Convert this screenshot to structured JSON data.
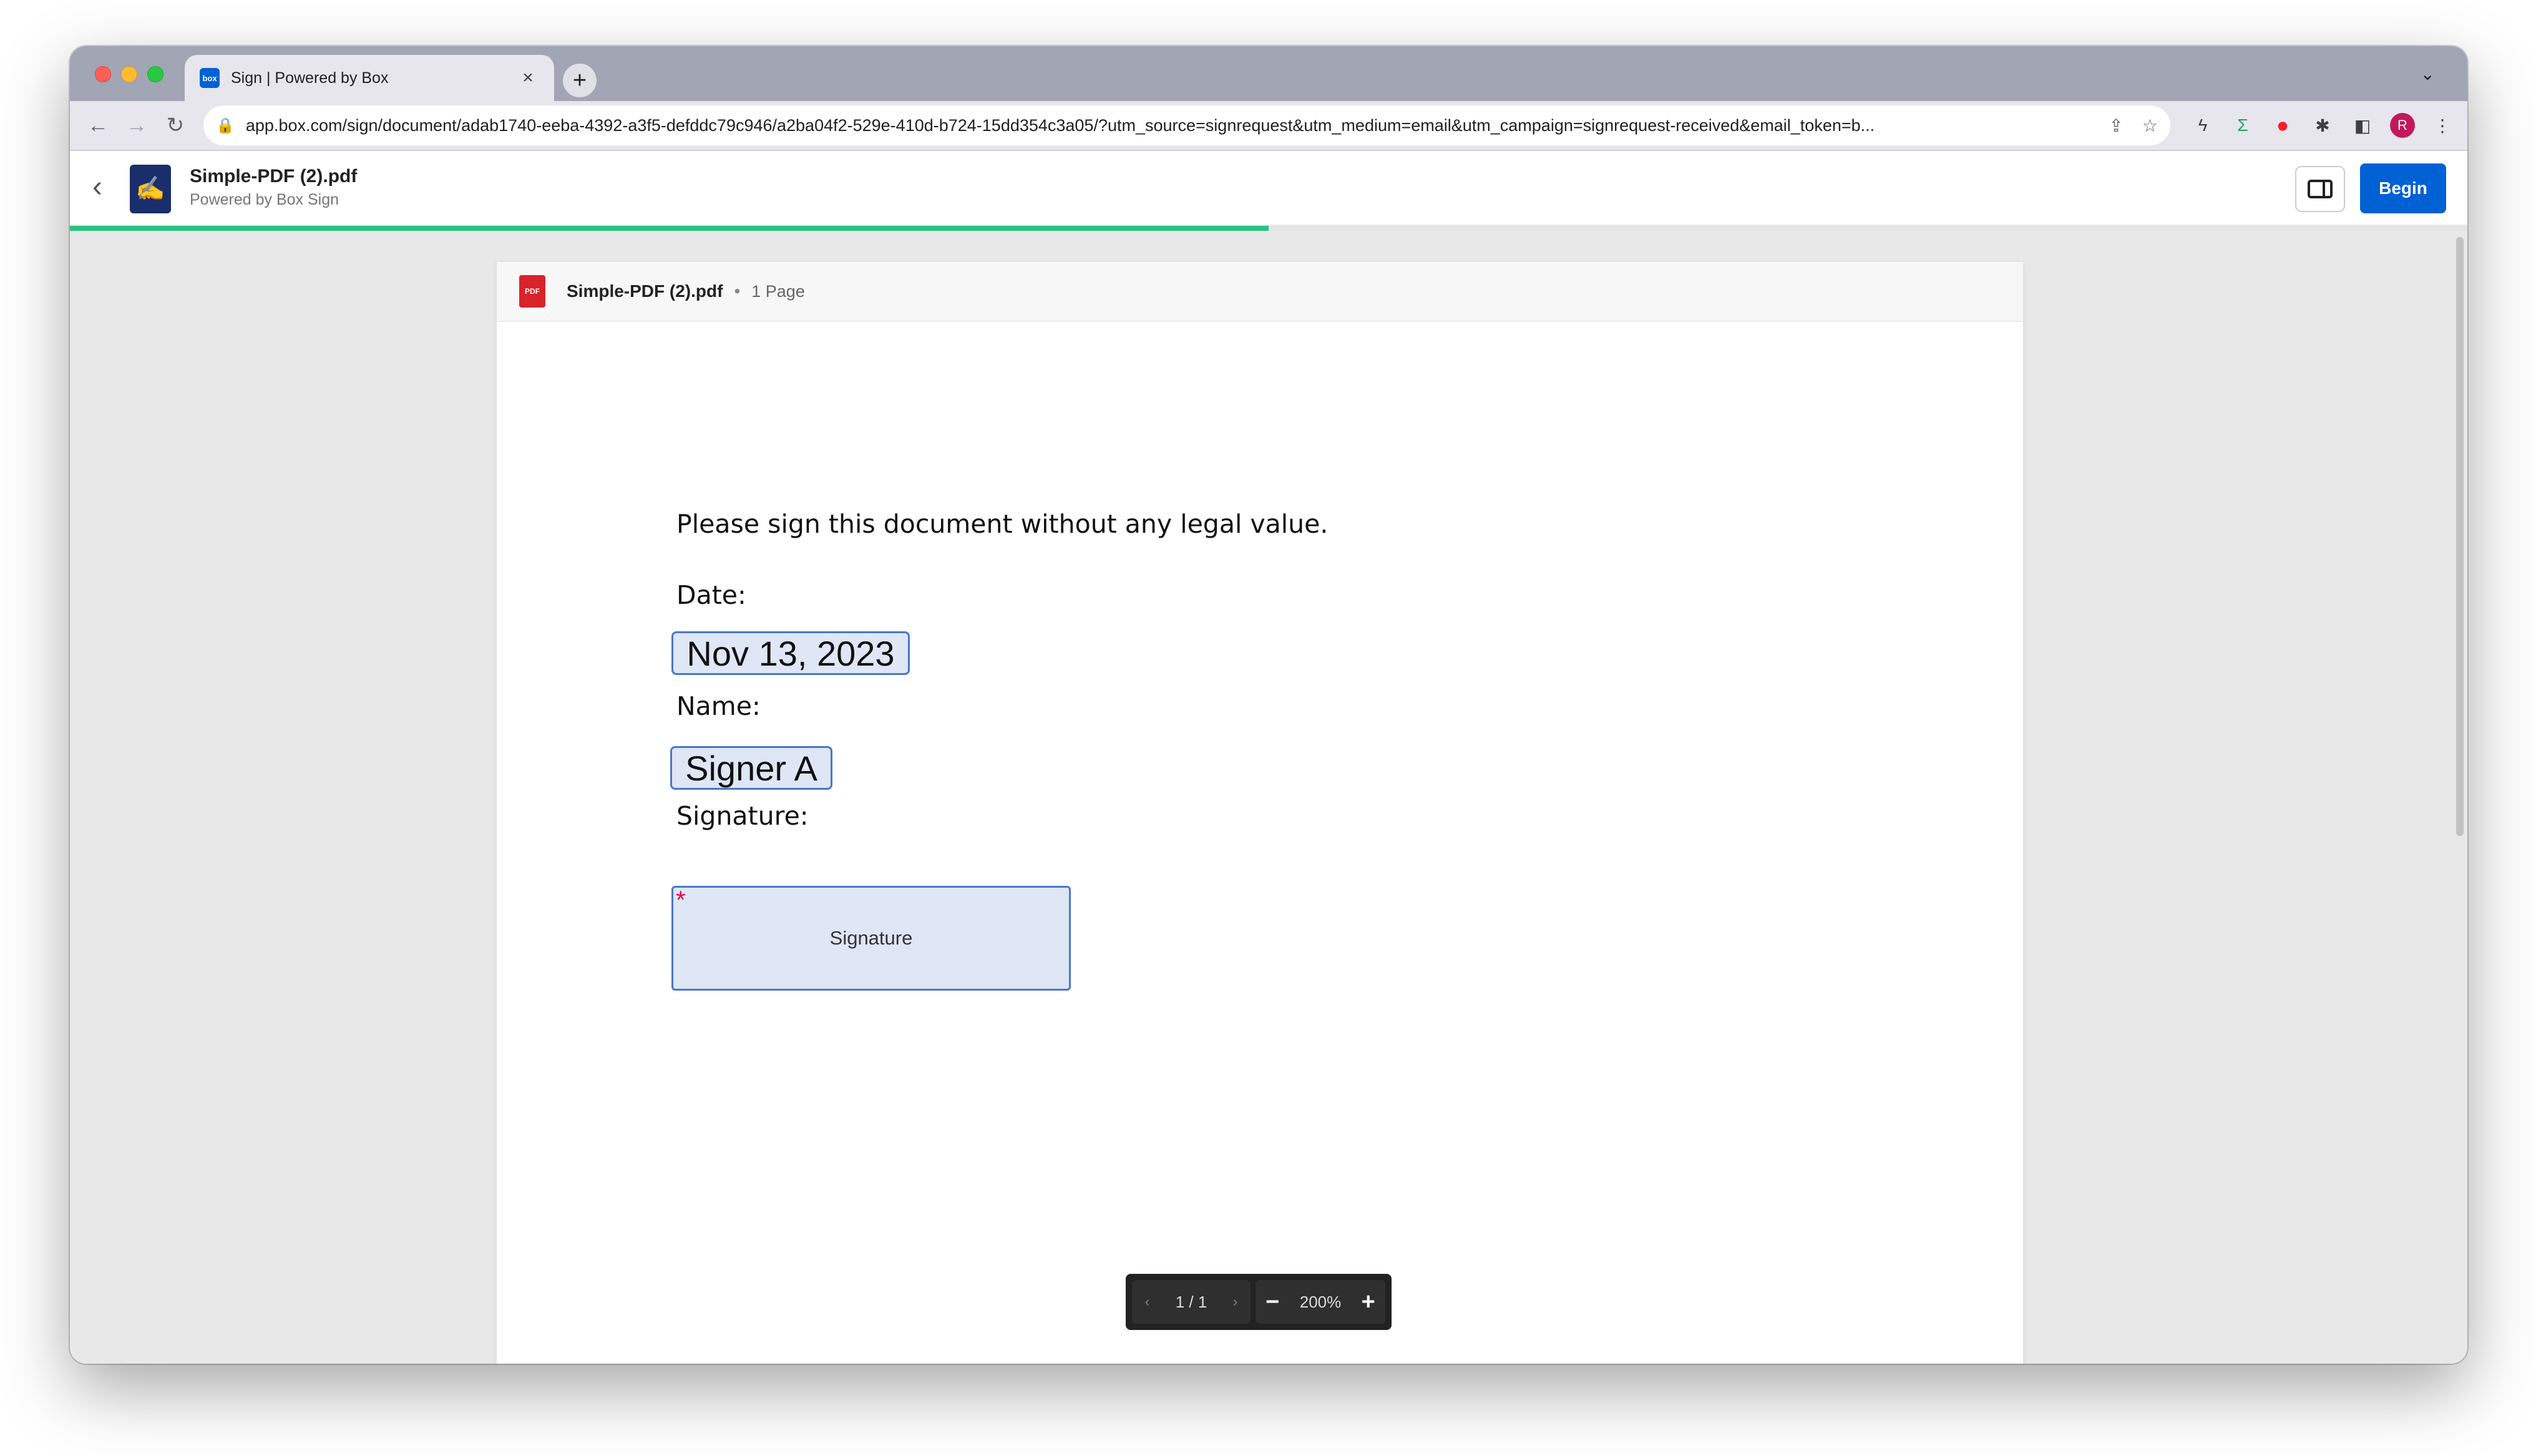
{
  "browser": {
    "tab_title": "Sign | Powered by Box",
    "tab_favicon_text": "box",
    "new_tab_icon": "+",
    "url": "app.box.com/sign/document/adab1740-eeba-4392-a3f5-defddc79c946/a2ba04f2-529e-410d-b724-15dd354c3a05/?utm_source=signrequest&utm_medium=email&utm_campaign=signrequest-received&email_token=b...",
    "avatar_initial": "R"
  },
  "header": {
    "title": "Simple-PDF (2).pdf",
    "subtitle": "Powered by Box Sign",
    "begin_label": "Begin",
    "progress": 0.5
  },
  "document": {
    "filename": "Simple-PDF (2).pdf",
    "pages_label": "1 Page",
    "pdf_icon_text": "PDF",
    "instruction": "Please sign this document without any legal value.",
    "date_label": "Date:",
    "date_value": "Nov 13, 2023",
    "name_label": "Name:",
    "name_value": "Signer A",
    "signature_label": "Signature:",
    "signature_placeholder": "Signature",
    "required_marker": "*"
  },
  "zoombar": {
    "page_indicator": "1 / 1",
    "zoom_level": "200%"
  },
  "colors": {
    "accent": "#0061d5",
    "progress": "#26c281",
    "field_bg": "#dfe6f5",
    "field_border": "#4878c8",
    "required": "#e6004c"
  }
}
